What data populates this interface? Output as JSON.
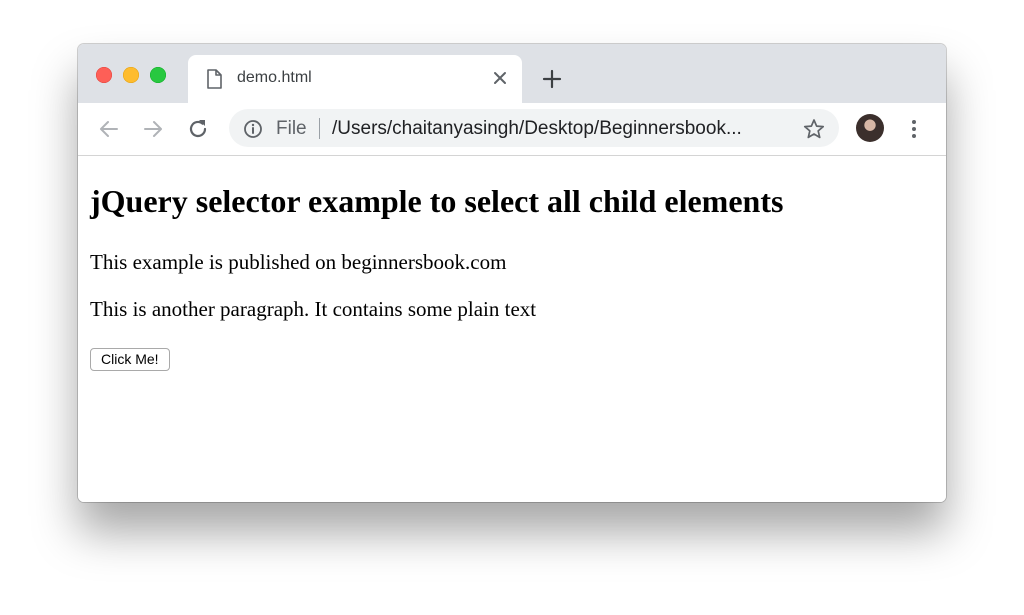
{
  "browser": {
    "tab": {
      "title": "demo.html"
    },
    "toolbar": {
      "scheme_label": "File",
      "url": "/Users/chaitanyasingh/Desktop/Beginnersbook..."
    },
    "icons": [
      "file-icon",
      "close-icon",
      "plus-icon",
      "back-arrow-icon",
      "forward-arrow-icon",
      "reload-icon",
      "info-icon",
      "star-icon",
      "kebab-menu-icon"
    ],
    "colors": {
      "close_light": "#fe5f57",
      "minimize_light": "#febc2e",
      "maximize_light": "#28c840",
      "tabstrip": "#dee1e6",
      "omnibox": "#f1f3f4"
    }
  },
  "page": {
    "heading": "jQuery selector example to select all child elements",
    "paragraphs": [
      "This example is published on beginnersbook.com",
      "This is another paragraph. It contains some plain text"
    ],
    "button_label": "Click Me!"
  }
}
